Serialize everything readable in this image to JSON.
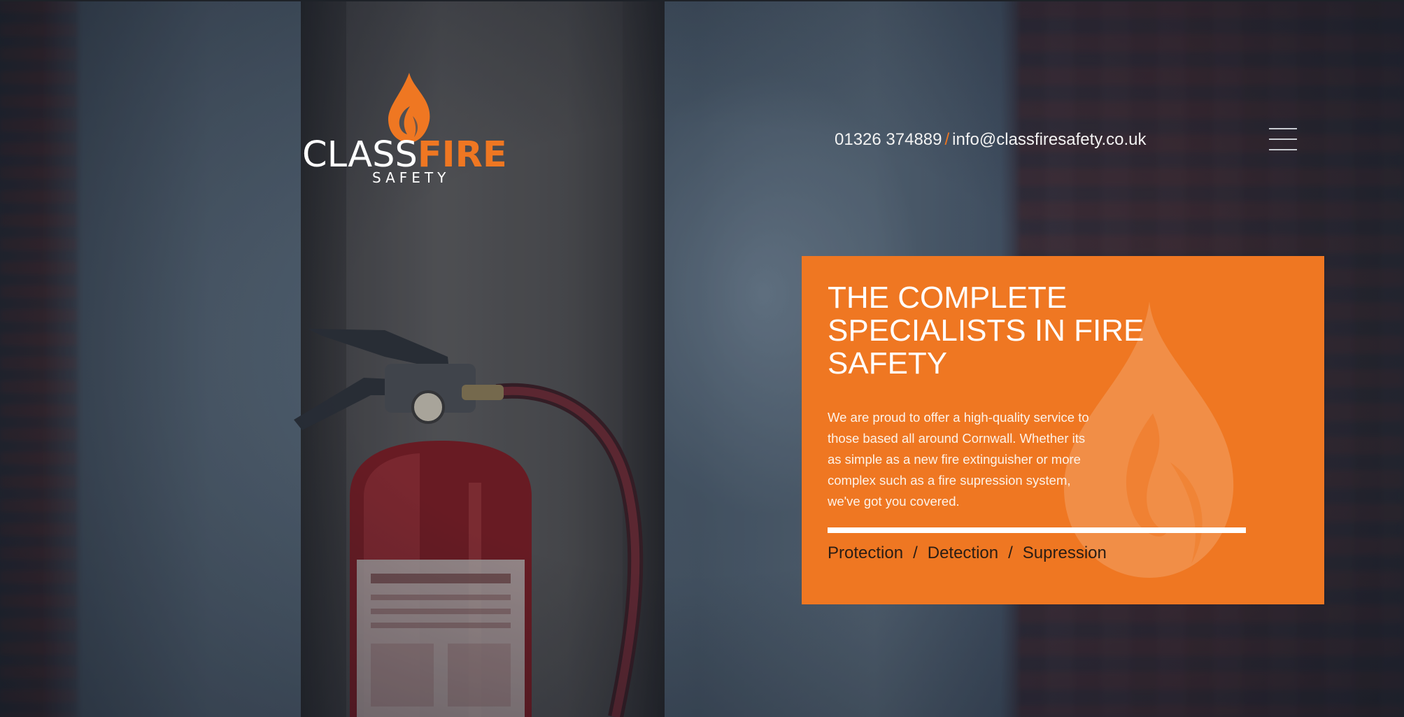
{
  "header": {
    "logo": {
      "wordmark_class": "CLASS",
      "wordmark_fire": "FIRE",
      "subtitle": "SAFETY"
    },
    "contact": {
      "phone": "01326 374889",
      "separator": "/",
      "email": "info@classfiresafety.co.uk"
    },
    "menu_icon": "hamburger-menu-icon"
  },
  "hero_panel": {
    "title": "THE COMPLETE SPECIALISTS IN FIRE SAFETY",
    "body": "We are proud to offer a high-quality service to those based all around Cornwall. Whether its as simple as a new fire extinguisher or more complex such as a fire supression system, we've got you covered.",
    "services": [
      "Protection",
      "Detection",
      "Supression"
    ],
    "services_separator": "/",
    "background_icon": "flame-icon"
  },
  "colors": {
    "brand_orange": "#ef7722",
    "panel_background": "#ef7722",
    "text_light": "#ffffff",
    "services_text": "#2a1d14"
  }
}
